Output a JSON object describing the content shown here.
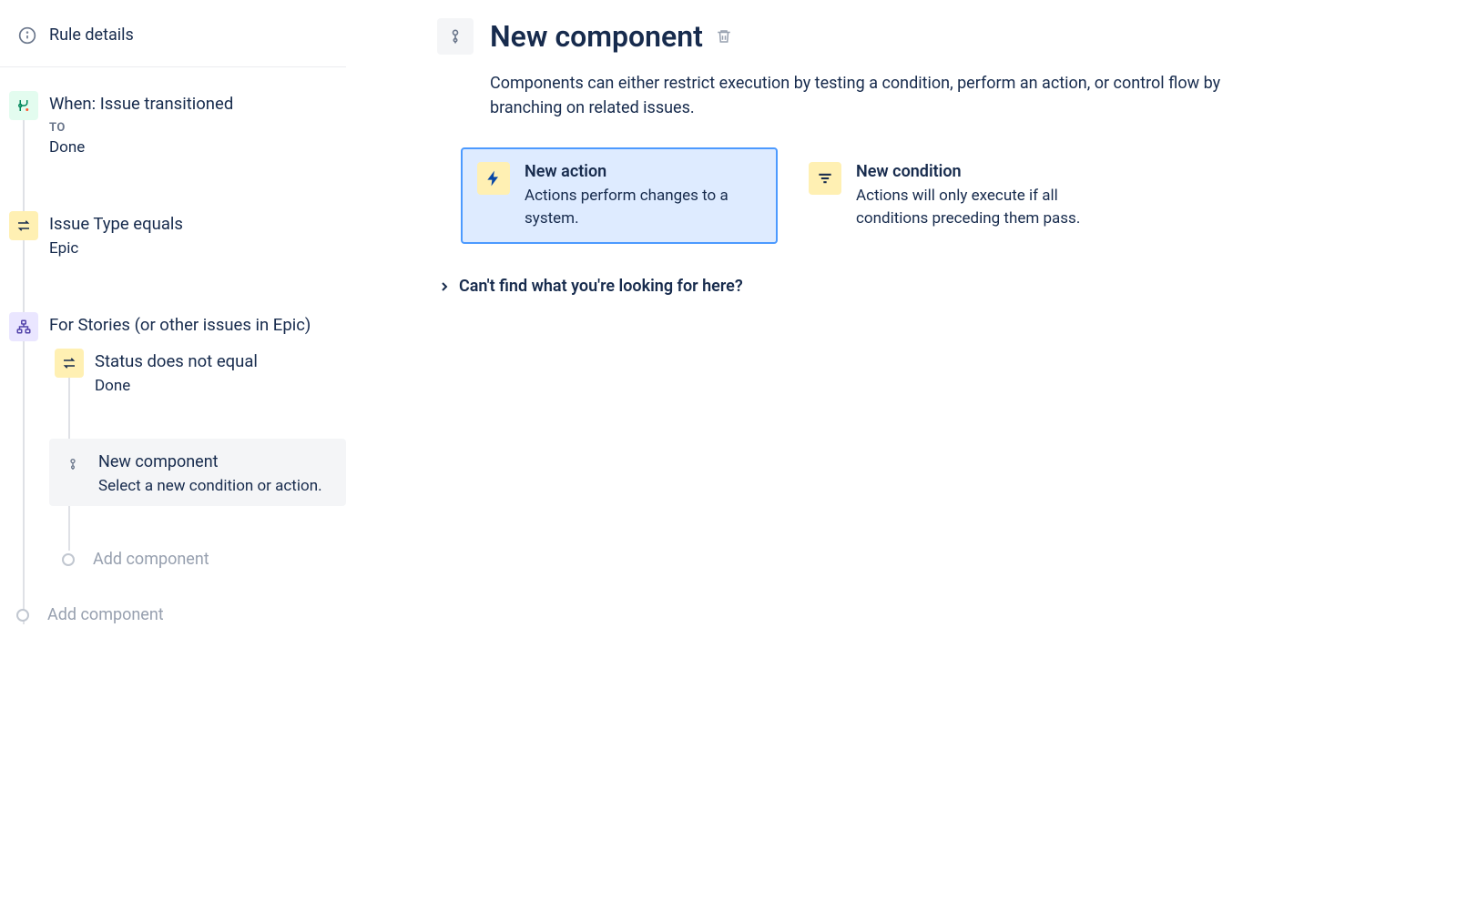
{
  "sidebar": {
    "rule_details_label": "Rule details",
    "trigger": {
      "title": "When: Issue transitioned",
      "sub_label": "TO",
      "value": "Done"
    },
    "condition1": {
      "title": "Issue Type equals",
      "value": "Epic"
    },
    "branch": {
      "title": "For Stories (or other issues in Epic)",
      "condition": {
        "title": "Status does not equal",
        "value": "Done"
      },
      "new_component": {
        "title": "New component",
        "subtitle": "Select a new condition or action."
      },
      "add_label": "Add component"
    },
    "add_label_outer": "Add component"
  },
  "main": {
    "title": "New component",
    "description": "Components can either restrict execution by testing a condition, perform an action, or control flow by branching on related issues.",
    "cards": {
      "action": {
        "title": "New action",
        "desc": "Actions perform changes to a system."
      },
      "condition": {
        "title": "New condition",
        "desc": "Actions will only execute if all conditions preceding them pass."
      }
    },
    "help_link": "Can't find what you're looking for here?"
  }
}
